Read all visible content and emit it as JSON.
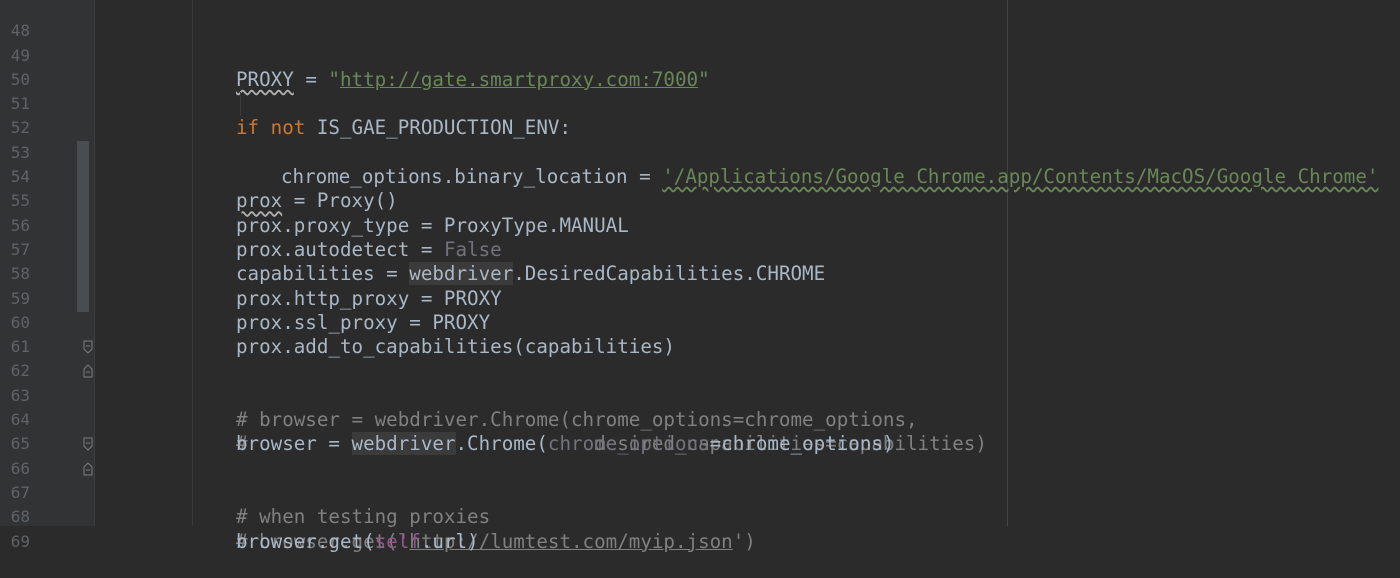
{
  "editor": {
    "colors": {
      "background": "#2b2b2b",
      "gutter": "#313335",
      "line_number": "#606366",
      "text": "#a9b7c6",
      "keyword": "#cc7832",
      "string": "#6a8759",
      "comment": "#808080",
      "self": "#94558d"
    },
    "line_numbers": [
      "48",
      "49",
      "50",
      "51",
      "52",
      "53",
      "54",
      "55",
      "56",
      "57",
      "58",
      "59",
      "60",
      "61",
      "62",
      "63",
      "64",
      "65",
      "66",
      "67",
      "68",
      "69"
    ],
    "code": {
      "l49": {
        "var": "PROXY",
        "eq": " = ",
        "q1": "\"",
        "url": "http://gate.smartproxy.com:7000",
        "q2": "\""
      },
      "l51": {
        "kw": "if not",
        "rest": " IS_GAE_PRODUCTION_ENV:"
      },
      "l52": {
        "pre": "chrome_options.binary_location = ",
        "str": "'/Applications/Google Chrome.app/Contents/MacOS/Google Chrome'"
      },
      "l54": {
        "var": "prox",
        "rest": " = Proxy()"
      },
      "l55": {
        "text": "prox.proxy_type = ProxyType.MANUAL"
      },
      "l56": {
        "pre": "prox.autodetect = ",
        "kw": "False"
      },
      "l57": {
        "pre": "capabilities = ",
        "mod": "webdriver",
        "rest": ".DesiredCapabilities.CHROME"
      },
      "l58": {
        "text": "prox.http_proxy = PROXY"
      },
      "l59": {
        "text": "prox.ssl_proxy = PROXY"
      },
      "l60": {
        "text": "prox.add_to_capabilities(capabilities)"
      },
      "l62": {
        "text": "# browser = webdriver.Chrome(chrome_options=chrome_options,"
      },
      "l63": {
        "text": "#                              desired_capabilities=capabilities)"
      },
      "l64": {
        "pre": "browser = ",
        "mod": "webdriver",
        "mid": ".Chrome(",
        "param": "chrome_options",
        "rest": "=chrome_options)"
      },
      "l66": {
        "text": "# when testing proxies"
      },
      "l67": {
        "pre": "# browser.get('",
        "url": "http://lumtest.com/myip.json",
        "post": "')"
      },
      "l68": {
        "pre": "browser.get(",
        "self": "self",
        "rest": ".url)"
      }
    },
    "icons": {
      "fold": "fold-start-icon",
      "fold_end": "fold-end-icon"
    }
  }
}
